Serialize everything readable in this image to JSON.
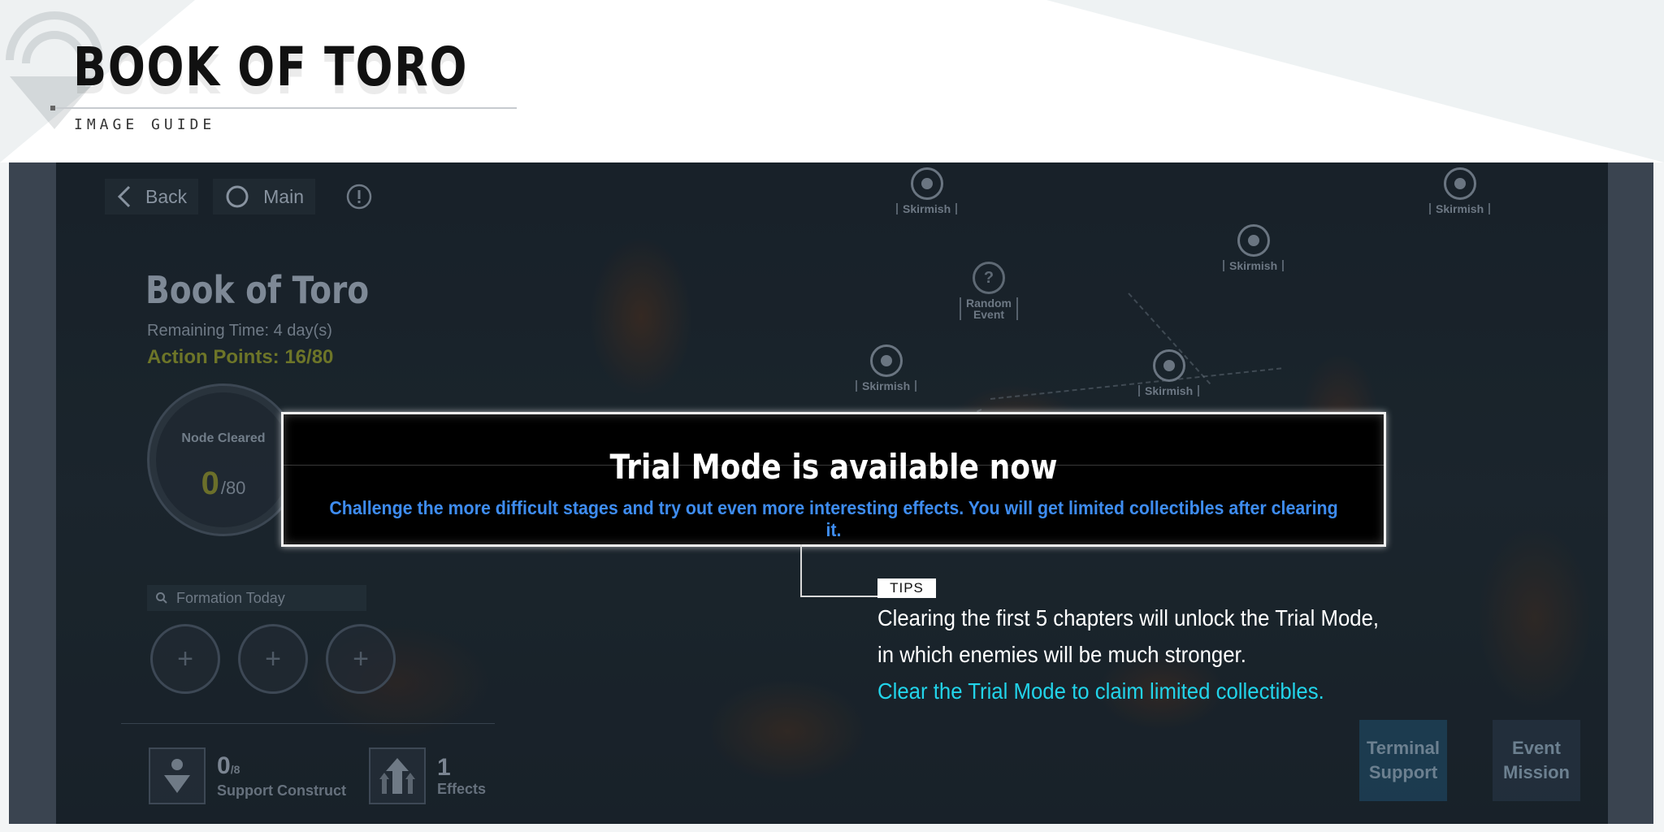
{
  "guide": {
    "title": "BOOK OF TORO",
    "subtitle": "IMAGE GUIDE"
  },
  "nav": {
    "back_label": "Back",
    "main_label": "Main"
  },
  "event": {
    "title": "Book of Toro",
    "remaining": "Remaining Time: 4 day(s)",
    "action_points": "Action Points: 16/80",
    "node_cleared_label": "Node Cleared",
    "node_cleared_value": "0",
    "node_cleared_total": "/80",
    "formation_label": "Formation Today",
    "support_value": "0",
    "support_total": "/8",
    "support_label": "Support Construct",
    "effects_value": "1",
    "effects_label": "Effects"
  },
  "map_nodes": {
    "skirmish": "Skirmish",
    "random_1": "Random",
    "random_2": "Event"
  },
  "buttons": {
    "terminal_1": "Terminal",
    "terminal_2": "Support",
    "mission_1": "Event",
    "mission_2": "Mission"
  },
  "banner": {
    "title": "Trial Mode is available now",
    "description": "Challenge the more difficult stages and try out even more interesting effects. You will get limited collectibles after clearing it."
  },
  "tips": {
    "tag": "TIPS",
    "line1": "Clearing the first 5 chapters will unlock the Trial Mode,",
    "line2": "in which enemies will be much stronger.",
    "line3": "Clear the Trial Mode to claim limited collectibles."
  },
  "colors": {
    "accent_blue": "#3e8cf0",
    "highlight_cyan": "#22d4ea",
    "action_points": "#6d7528"
  }
}
